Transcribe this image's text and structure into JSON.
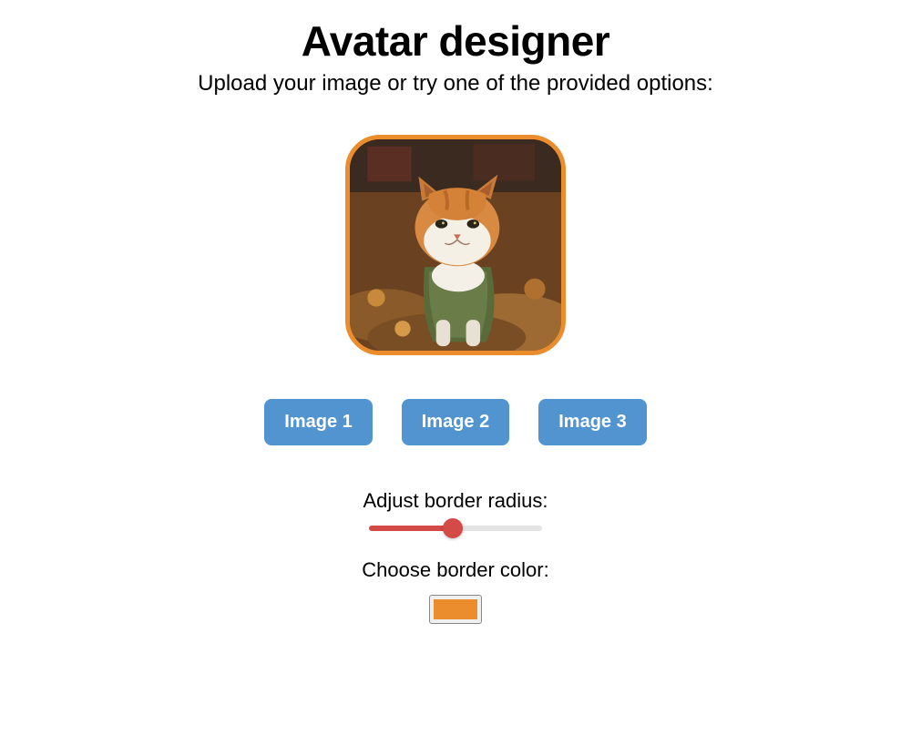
{
  "title": "Avatar designer",
  "subtitle": "Upload your image or try one of the provided options:",
  "preview": {
    "border_color": "#eb8d2c",
    "border_radius_px": 38
  },
  "image_buttons": [
    {
      "label": "Image 1"
    },
    {
      "label": "Image 2"
    },
    {
      "label": "Image 3"
    }
  ],
  "controls": {
    "radius_label": "Adjust border radius:",
    "radius_value": 48,
    "radius_min": 0,
    "radius_max": 100,
    "color_label": "Choose border color:",
    "color_value": "#eb8d2c"
  }
}
